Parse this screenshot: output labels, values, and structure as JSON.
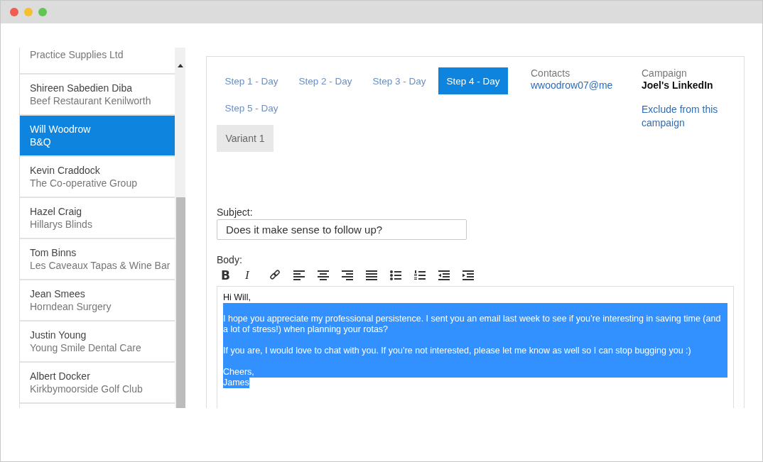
{
  "contacts": [
    {
      "company": "Practice Supplies Ltd",
      "selected": false
    },
    {
      "name": "Shireen Sabedien Diba",
      "company": "Beef Restaurant Kenilworth",
      "selected": false
    },
    {
      "name": "Will Woodrow",
      "company": "B&Q",
      "selected": true
    },
    {
      "name": "Kevin Craddock",
      "company": "The Co-operative Group",
      "selected": false
    },
    {
      "name": "Hazel Craig",
      "company": "Hillarys Blinds",
      "selected": false
    },
    {
      "name": "Tom Binns",
      "company": "Les Caveaux Tapas & Wine Bar",
      "selected": false
    },
    {
      "name": "Jean Smees",
      "company": "Horndean Surgery",
      "selected": false
    },
    {
      "name": "Justin Young",
      "company": "Young Smile Dental Care",
      "selected": false
    },
    {
      "name": "Albert Docker",
      "company": "Kirkbymoorside Golf Club",
      "selected": false
    }
  ],
  "steps": [
    {
      "label": "Step 1 - Day",
      "selected": false
    },
    {
      "label": "Step 2 - Day",
      "selected": false
    },
    {
      "label": "Step 3 - Day",
      "selected": false
    },
    {
      "label": "Step 4 - Day",
      "selected": true
    },
    {
      "label": "Step 5 - Day",
      "selected": false
    }
  ],
  "variant_button": "Variant 1",
  "contacts_info": {
    "label": "Contacts",
    "value": "wwoodrow07@me"
  },
  "campaign_info": {
    "label": "Campaign",
    "value": "Joel's LinkedIn",
    "link": "Exclude from this campaign"
  },
  "subject": {
    "label": "Subject:",
    "value": "Does it make sense to follow up?"
  },
  "body": {
    "label": "Body:",
    "toolbar": [
      {
        "kind": "bold",
        "label": "B"
      },
      {
        "kind": "italic",
        "label": "I"
      },
      {
        "kind": "link"
      },
      {
        "kind": "align-left"
      },
      {
        "kind": "align-center"
      },
      {
        "kind": "align-right"
      },
      {
        "kind": "justify"
      },
      {
        "kind": "bullets"
      },
      {
        "kind": "numbers"
      },
      {
        "kind": "outdent"
      },
      {
        "kind": "indent"
      }
    ],
    "lines": [
      {
        "text": "Hi Will,",
        "selected": false,
        "kind": "paragraph"
      },
      {
        "text": "I hope you appreciate my professional persistence. I sent you an email last week to see if you’re interesting in saving time (and a lot of stress!) when planning your rotas?",
        "selected": true,
        "kind": "paragraph"
      },
      {
        "text": "If you are, I would love to chat with you.  If you’re not interested, please let me know as well so I can stop bugging you :)",
        "selected": true,
        "kind": "paragraph"
      },
      {
        "text": "Cheers,",
        "selected": true,
        "kind": "line"
      },
      {
        "text": "James",
        "selected": true,
        "kind": "signature"
      }
    ]
  }
}
